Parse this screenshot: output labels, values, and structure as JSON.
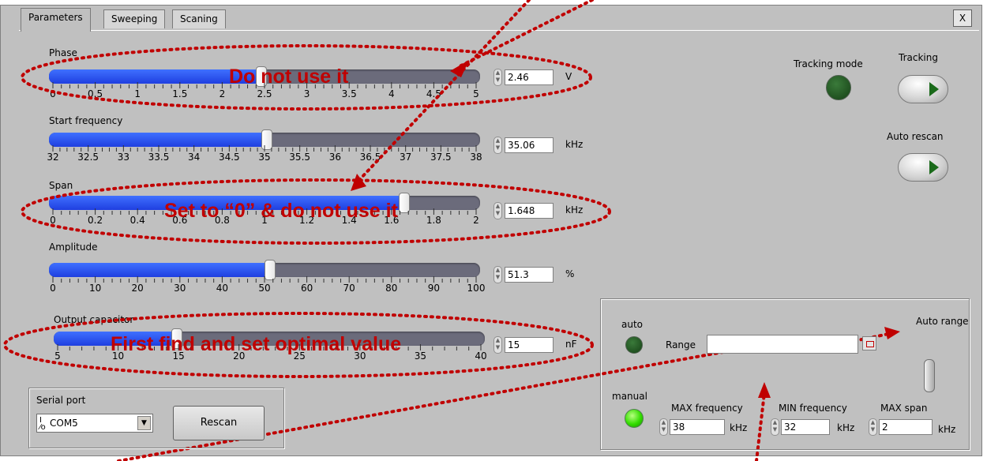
{
  "tabs": [
    {
      "label": "Parameters",
      "active": true
    },
    {
      "label": "Sweeping",
      "active": false
    },
    {
      "label": "Scaning",
      "active": false
    }
  ],
  "close_label": "X",
  "sliders": [
    {
      "label": "Phase",
      "value": "2.46",
      "unit": "V",
      "fraction": 0.492,
      "ticks": [
        "0",
        "0.5",
        "1",
        "1.5",
        "2",
        "2.5",
        "3",
        "3.5",
        "4",
        "4.5",
        "5"
      ]
    },
    {
      "label": "Start frequency",
      "value": "35.06",
      "unit": "kHz",
      "fraction": 0.506,
      "ticks": [
        "32",
        "32.5",
        "33",
        "33.5",
        "34",
        "34.5",
        "35",
        "35.5",
        "36",
        "36.5",
        "37",
        "37.5",
        "38"
      ]
    },
    {
      "label": "Span",
      "value": "1.648",
      "unit": "kHz",
      "fraction": 0.824,
      "ticks": [
        "0",
        "0.2",
        "0.4",
        "0.6",
        "0.8",
        "1",
        "1.2",
        "1.4",
        "1.6",
        "1.8",
        "2"
      ]
    },
    {
      "label": "Amplitude",
      "value": "51.3",
      "unit": "%",
      "fraction": 0.513,
      "ticks": [
        "0",
        "10",
        "20",
        "30",
        "40",
        "50",
        "60",
        "70",
        "80",
        "90",
        "100"
      ]
    },
    {
      "label": "Output capacitor",
      "value": "15",
      "unit": "nF",
      "fraction": 0.286,
      "ticks": [
        "5",
        "10",
        "15",
        "20",
        "25",
        "30",
        "35",
        "40"
      ]
    }
  ],
  "annotations": {
    "phase": "Do not use it",
    "span": "Set to “0” & do not use it",
    "capacitor": "First find and set optimal value"
  },
  "tracking": {
    "mode_label": "Tracking mode",
    "tracking_label": "Tracking",
    "auto_rescan_label": "Auto rescan"
  },
  "range_panel": {
    "auto_label": "auto",
    "manual_label": "manual",
    "range_label": "Range",
    "range_value": "",
    "auto_range_label": "Auto range",
    "max_freq_label": "MAX frequency",
    "max_freq_value": "38",
    "min_freq_label": "MIN frequency",
    "min_freq_value": "32",
    "max_span_label": "MAX span",
    "max_span_value": "2",
    "unit": "kHz"
  },
  "serial": {
    "label": "Serial port",
    "value": "COM5",
    "rescan_label": "Rescan"
  },
  "colors": {
    "annotation": "#c00000",
    "slider_fill": "#2a50f0",
    "led_on": "#33ff00",
    "led_off": "#1e5a1e"
  }
}
